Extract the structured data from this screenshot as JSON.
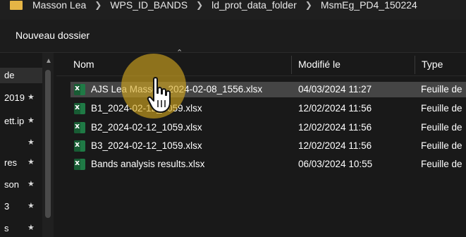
{
  "breadcrumb": [
    "Masson Lea",
    "WPS_ID_BANDS",
    "ld_prot_data_folder",
    "MsmEg_PD4_150224"
  ],
  "toolbar": {
    "new_folder_label": "Nouveau dossier"
  },
  "nav_pane": {
    "items": [
      {
        "label": "de",
        "pinned": false,
        "selected": true
      },
      {
        "label": "2019",
        "pinned": true,
        "selected": false
      },
      {
        "label": "ett.ip",
        "pinned": true,
        "selected": false
      },
      {
        "label": "",
        "pinned": true,
        "selected": false
      },
      {
        "label": "res",
        "pinned": true,
        "selected": false
      },
      {
        "label": "son",
        "pinned": true,
        "selected": false
      },
      {
        "label": "3",
        "pinned": true,
        "selected": false
      },
      {
        "label": "s",
        "pinned": true,
        "selected": false
      }
    ]
  },
  "columns": {
    "name": "Nom",
    "modified": "Modifié le",
    "type": "Type"
  },
  "files": [
    {
      "name": "AJS Lea Masson_2024-02-08_1556.xlsx",
      "modified": "04/03/2024 11:27",
      "type": "Feuille de",
      "selected": true
    },
    {
      "name": "B1_2024-02-12_1059.xlsx",
      "modified": "12/02/2024 11:56",
      "type": "Feuille de",
      "selected": false
    },
    {
      "name": "B2_2024-02-12_1059.xlsx",
      "modified": "12/02/2024 11:56",
      "type": "Feuille de",
      "selected": false
    },
    {
      "name": "B3_2024-02-12_1059.xlsx",
      "modified": "12/02/2024 11:56",
      "type": "Feuille de",
      "selected": false
    },
    {
      "name": "Bands analysis results.xlsx",
      "modified": "06/03/2024 10:55",
      "type": "Feuille de",
      "selected": false
    }
  ],
  "icons": {
    "folder": "folder-icon",
    "file": "excel-file-icon",
    "pin": "pin-icon",
    "cursor": "hand-pointer-icon",
    "sort": "sort-ascending-icon"
  },
  "colors": {
    "background": "#191919",
    "selected_row": "#454545",
    "excel_green": "#1f7a45",
    "cursor_highlight": "#d6aa1e",
    "folder_yellow": "#e6b545"
  }
}
